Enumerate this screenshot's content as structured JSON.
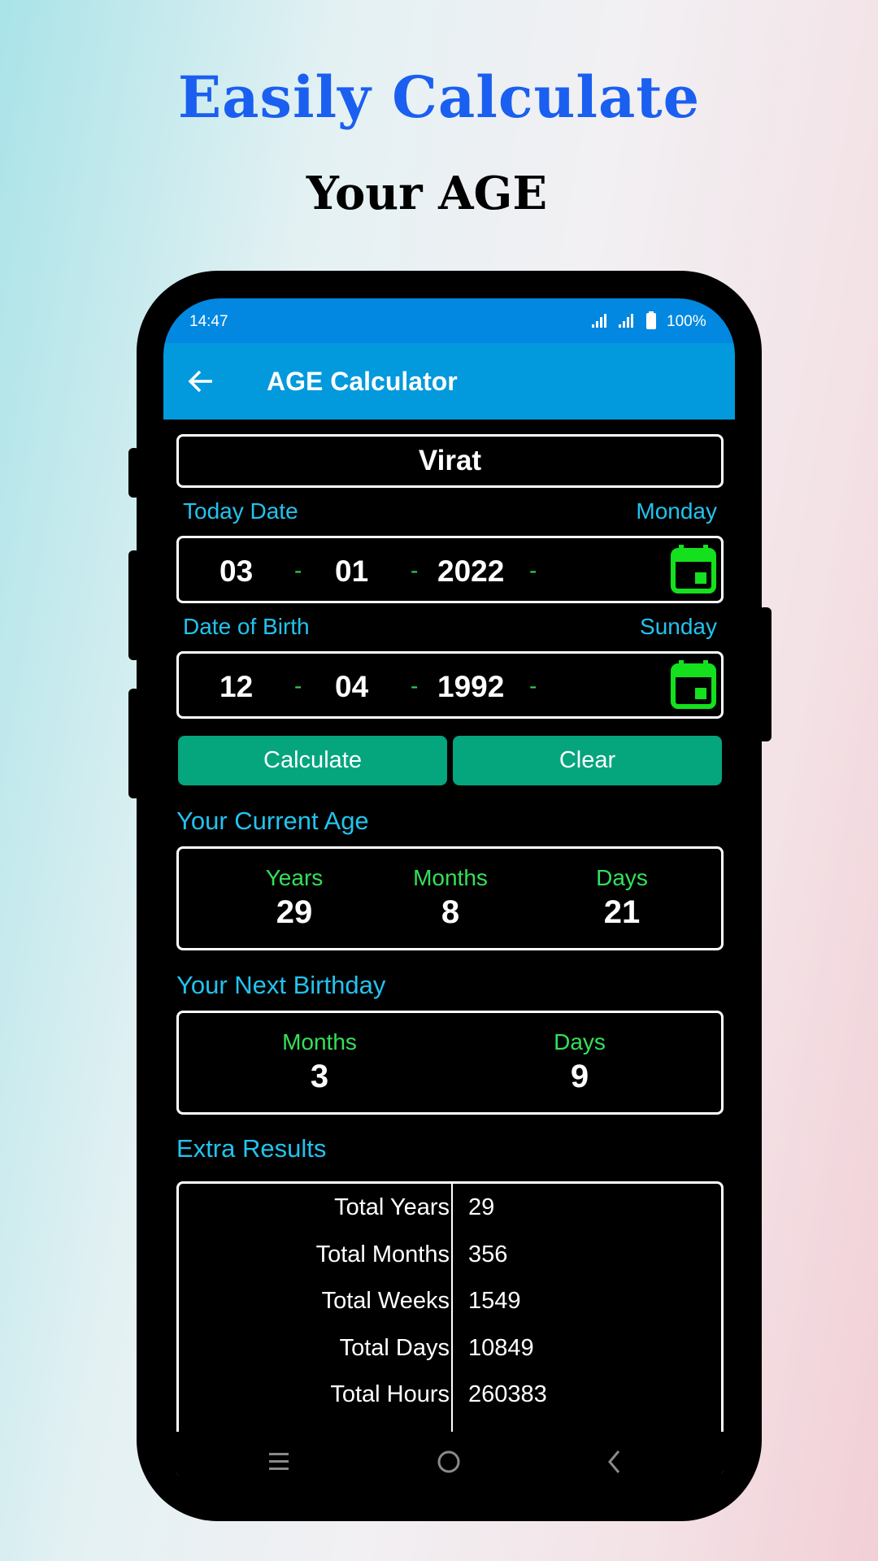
{
  "headline": {
    "line1": "Easily Calculate",
    "line2": "Your AGE",
    "line1_color": "#1a5ff0"
  },
  "status_bar": {
    "time": "14:47",
    "battery": "100%",
    "icons": [
      "signal-icon",
      "signal-icon",
      "battery-icon"
    ]
  },
  "app_bar": {
    "title": "AGE Calculator",
    "back_icon": "arrow-left-icon",
    "color": "#0299dd"
  },
  "name_field": {
    "value": "Virat"
  },
  "today": {
    "label": "Today Date",
    "weekday": "Monday",
    "day": "03",
    "month": "01",
    "year": "2022",
    "separator": "-",
    "icon": "calendar-icon"
  },
  "birth": {
    "label": "Date of Birth",
    "weekday": "Sunday",
    "day": "12",
    "month": "04",
    "year": "1992",
    "separator": "-",
    "icon": "calendar-icon"
  },
  "buttons": {
    "calculate": "Calculate",
    "clear": "Clear",
    "color": "#05a57e"
  },
  "current_age": {
    "title": "Your Current Age",
    "years_label": "Years",
    "years": "29",
    "months_label": "Months",
    "months": "8",
    "days_label": "Days",
    "days": "21"
  },
  "next_birthday": {
    "title": "Your Next Birthday",
    "months_label": "Months",
    "months": "3",
    "days_label": "Days",
    "days": "9"
  },
  "extra": {
    "title": "Extra Results",
    "rows": [
      {
        "label": "Total Years",
        "value": "29"
      },
      {
        "label": "Total Months",
        "value": "356"
      },
      {
        "label": "Total Weeks",
        "value": "1549"
      },
      {
        "label": "Total Days",
        "value": "10849"
      },
      {
        "label": "Total Hours",
        "value": "260383"
      }
    ]
  },
  "nav_bar": {
    "icons": [
      "recents-icon",
      "home-icon",
      "back-icon"
    ]
  }
}
